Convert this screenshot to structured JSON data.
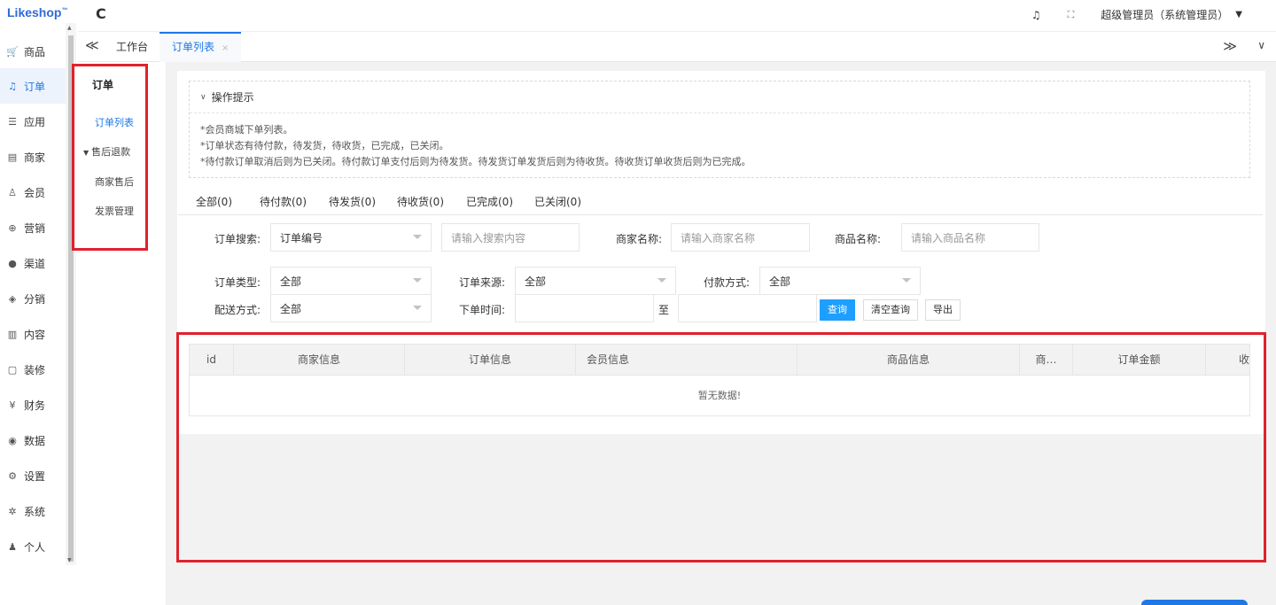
{
  "logo": {
    "text": "Likeshop",
    "tm": "™"
  },
  "rail": {
    "items": [
      {
        "label": "商品",
        "icon": "cart-icon",
        "glyph": "🛒"
      },
      {
        "label": "订单",
        "icon": "bell-icon",
        "glyph": "♫"
      },
      {
        "label": "应用",
        "icon": "apps-icon",
        "glyph": "☰"
      },
      {
        "label": "商家",
        "icon": "store-icon",
        "glyph": "▤"
      },
      {
        "label": "会员",
        "icon": "user-icon",
        "glyph": "♙"
      },
      {
        "label": "营销",
        "icon": "marketing-icon",
        "glyph": "⊕"
      },
      {
        "label": "渠道",
        "icon": "channel-icon",
        "glyph": "●"
      },
      {
        "label": "分销",
        "icon": "layers-icon",
        "glyph": "◈"
      },
      {
        "label": "内容",
        "icon": "book-icon",
        "glyph": "▥"
      },
      {
        "label": "装修",
        "icon": "decorate-icon",
        "glyph": "▢"
      },
      {
        "label": "财务",
        "icon": "yen-icon",
        "glyph": "¥"
      },
      {
        "label": "数据",
        "icon": "data-icon",
        "glyph": "◉"
      },
      {
        "label": "设置",
        "icon": "gear-icon",
        "glyph": "⚙"
      },
      {
        "label": "系统",
        "icon": "system-icon",
        "glyph": "✲"
      },
      {
        "label": "个人",
        "icon": "person-icon",
        "glyph": "♟"
      }
    ],
    "active_index": 1
  },
  "submenu": {
    "title": "订单",
    "items": [
      {
        "label": "订单列表",
        "active": true
      },
      {
        "label": "售后退款",
        "prefix": "▼"
      },
      {
        "label": "商家售后"
      },
      {
        "label": "发票管理"
      }
    ]
  },
  "topbar": {
    "refresh_glyph": "C",
    "bell_glyph": "🔔",
    "fullscreen_glyph": "⛶",
    "user_label": "超级管理员（系统管理员）",
    "caret": "▼"
  },
  "tabbar": {
    "back_glyph": "≪",
    "forward_glyph": "≫",
    "more_glyph": "∨",
    "tabs": [
      {
        "label": "工作台"
      },
      {
        "label": "订单列表",
        "close": "×",
        "active": true
      }
    ]
  },
  "tips": {
    "title": "操作提示",
    "chevron": "∨",
    "lines": [
      "*会员商城下单列表。",
      "*订单状态有待付款，待发货，待收货，已完成，已关闭。",
      "*待付款订单取消后则为已关闭。待付款订单支付后则为待发货。待发货订单发货后则为待收货。待收货订单收货后则为已完成。"
    ]
  },
  "status_tabs": [
    "全部(0)",
    "待付款(0)",
    "待发货(0)",
    "待收货(0)",
    "已完成(0)",
    "已关闭(0)"
  ],
  "filters": {
    "search_label": "订单搜索:",
    "search_type": "订单编号",
    "search_placeholder": "请输入搜索内容",
    "merchant_label": "商家名称:",
    "merchant_placeholder": "请输入商家名称",
    "goods_label": "商品名称:",
    "goods_placeholder": "请输入商品名称",
    "order_type_label": "订单类型:",
    "order_type_value": "全部",
    "order_source_label": "订单来源:",
    "order_source_value": "全部",
    "pay_method_label": "付款方式:",
    "pay_method_value": "全部",
    "delivery_label": "配送方式:",
    "delivery_value": "全部",
    "time_label": "下单时间:",
    "time_to": "至",
    "query_button": "查询",
    "clear_button": "清空查询",
    "export_button": "导出"
  },
  "table": {
    "columns": [
      "id",
      "商家信息",
      "订单信息",
      "会员信息",
      "商品信息",
      "商…",
      "订单金额",
      "收"
    ],
    "empty_text": "暂无数据!"
  }
}
